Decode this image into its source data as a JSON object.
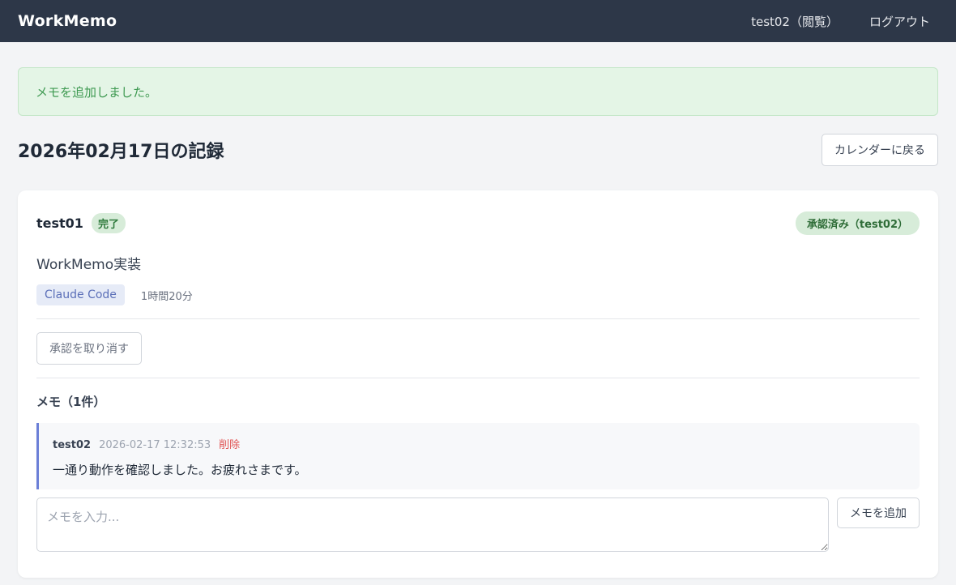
{
  "header": {
    "brand": "WorkMemo",
    "user": "test02（閲覧）",
    "logout": "ログアウト"
  },
  "alert": {
    "message": "メモを追加しました。"
  },
  "page": {
    "title": "2026年02月17日の記録",
    "back_button": "カレンダーに戻る"
  },
  "record": {
    "username": "test01",
    "status": "完了",
    "approval": "承認済み（test02）",
    "task_title": "WorkMemo実装",
    "tag": "Claude Code",
    "duration": "1時間20分",
    "cancel_approval_button": "承認を取り消す",
    "memos_heading": "メモ（1件）",
    "memos": [
      {
        "author": "test02",
        "timestamp": "2026-02-17 12:32:53",
        "delete_label": "削除",
        "text": "一通り動作を確認しました。お疲れさまです。"
      }
    ],
    "memo_input": {
      "value": "",
      "placeholder": "メモを入力..."
    },
    "add_memo_button": "メモを追加"
  },
  "colors": {
    "navbar": "#2d3748",
    "alert_bg": "#e4f5e6",
    "alert_text": "#3f9a52",
    "badge_bg": "#d7ecd9",
    "tag_bg": "#e6ebf7",
    "memo_border": "#6b7fd7",
    "delete": "#e05252"
  }
}
